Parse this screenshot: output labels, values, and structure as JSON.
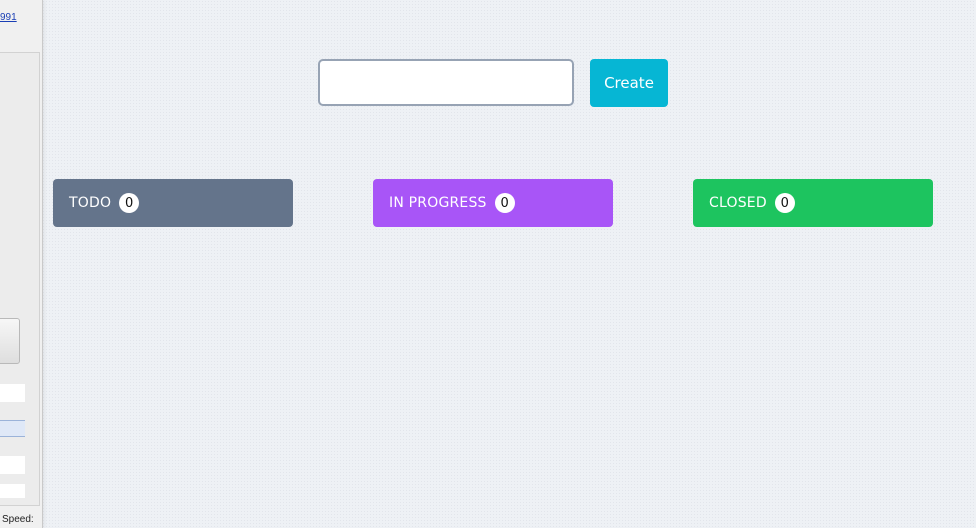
{
  "side_panel": {
    "link_text": "991",
    "speed_label": "Speed:"
  },
  "task_form": {
    "input_value": "",
    "input_placeholder": "",
    "create_label": "Create"
  },
  "columns": [
    {
      "title": "TODO",
      "count": "0",
      "color": "#64748b"
    },
    {
      "title": "IN PROGRESS",
      "count": "0",
      "color": "#a855f7"
    },
    {
      "title": "CLOSED",
      "count": "0",
      "color": "#1dc45f"
    }
  ],
  "colors": {
    "accent": "#06b6d4",
    "background": "#eef1f5"
  }
}
